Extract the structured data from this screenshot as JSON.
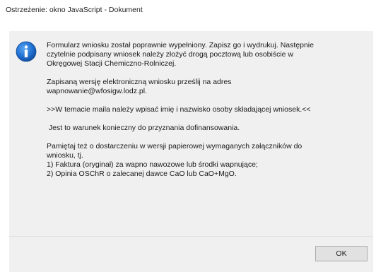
{
  "window": {
    "title": "Ostrzeżenie: okno JavaScript - Dokument"
  },
  "icon": {
    "name": "info-icon",
    "color": "#1f6fd0"
  },
  "message": {
    "para1": [
      "Formularz wniosku został poprawnie wypełniony. Zapisz go i wydrukuj. Następnie",
      "czytelnie podpisany wniosek należy złożyć drogą pocztową lub osobiście w",
      "Okręgowej Stacji Chemiczno-Rolniczej."
    ],
    "para2": [
      "Zapisaną wersję elektroniczną wniosku prześlij na adres",
      "wapnowanie@wfosigw.lodz.pl."
    ],
    "para3": ">>W temacie maila należy wpisać imię i nazwisko osoby składającej wniosek.<<",
    "para4": " Jest to warunek konieczny do przyznania dofinansowania.",
    "para5": [
      "Pamiętaj też o dostarczeniu w wersji papierowej wymaganych załączników do",
      "wniosku, tj.",
      "1) Faktura (oryginał) za wapno nawozowe lub środki wapnujące;",
      "2) Opinia OSChR o zalecanej dawce CaO lub CaO+MgO."
    ]
  },
  "buttons": {
    "ok_label": "OK"
  }
}
